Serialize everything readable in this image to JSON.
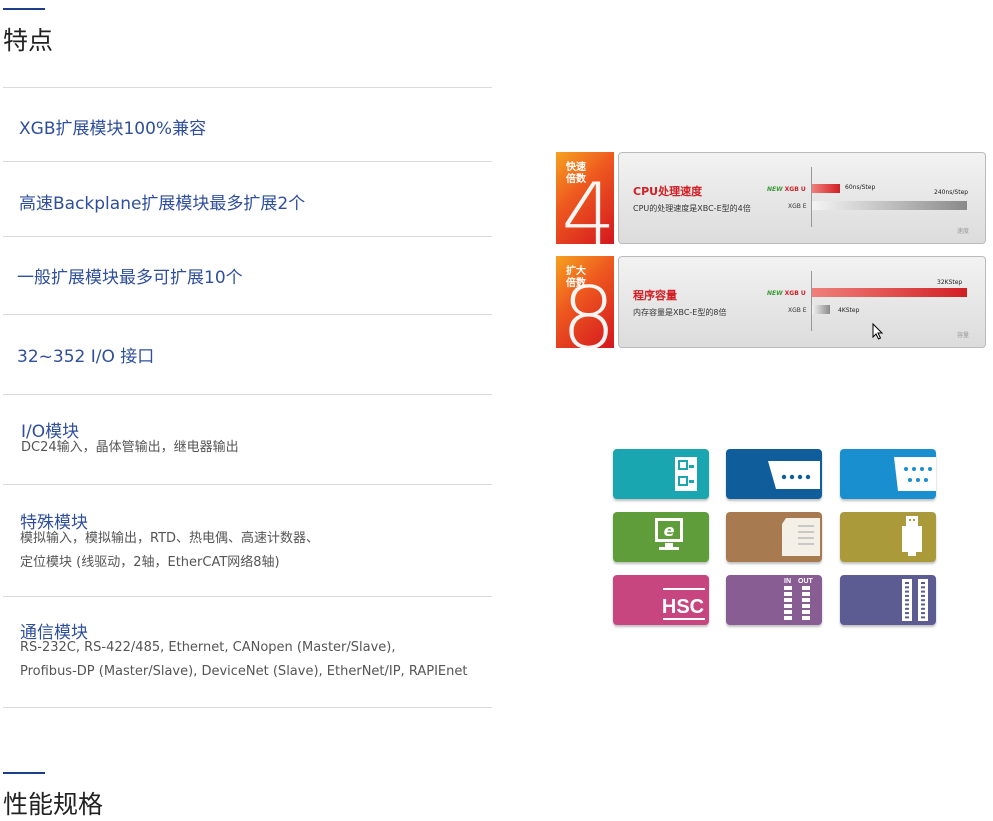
{
  "sections": {
    "features_title": "特点",
    "performance_title": "性能规格"
  },
  "features": [
    {
      "title": "XGB扩展模块100%兼容"
    },
    {
      "title": "高速Backplane扩展模块最多扩展2个"
    },
    {
      "title": "一般扩展模块最多可扩展10个"
    },
    {
      "title": "32~352 I/O 接口"
    },
    {
      "title": "I/O模块",
      "desc": [
        "DC24输入，晶体管输出，继电器输出"
      ]
    },
    {
      "title": "特殊模块",
      "desc": [
        "模拟输入，模拟输出，RTD、热电偶、高速计数器、",
        "定位模块 (线驱动，2轴，EtherCAT网络8轴)"
      ]
    },
    {
      "title": "通信模块",
      "desc": [
        " RS-232C, RS-422/485, Ethernet, CANopen  (Master/Slave),",
        "Profibus-DP (Master/Slave), DeviceNet (Slave), EtherNet/IP, RAPIEnet"
      ]
    }
  ],
  "promo": [
    {
      "badge": [
        "快速",
        "倍数"
      ],
      "number": "4",
      "title": "CPU处理速度",
      "subtitle": "CPU的处理速度是XBC-E型的4倍",
      "new_tag": "NEW",
      "model_u": "XGB U",
      "model_e": "XGB E",
      "u_value_label": "60ns/Step",
      "e_value_label": "240ns/Step",
      "unit": "速度"
    },
    {
      "badge": [
        "扩大",
        "倍数"
      ],
      "number": "8",
      "title": "程序容量",
      "subtitle": "内存容量是XBC-E型的8倍",
      "new_tag": "NEW",
      "model_u": "XGB U",
      "model_e": "XGB E",
      "u_value_label": "32KStep",
      "e_value_label": "4KStep",
      "unit": "容量"
    }
  ],
  "module_icons": [
    {
      "name": "io-terminal-icon",
      "color": "#1aa6b0"
    },
    {
      "name": "serial-port-icon",
      "color": "#0f5d9a"
    },
    {
      "name": "dsub-port-icon",
      "color": "#1a8fd0"
    },
    {
      "name": "ethernet-monitor-icon",
      "color": "#5f9d3b"
    },
    {
      "name": "memory-card-icon",
      "color": "#a87a4f"
    },
    {
      "name": "usb-icon",
      "color": "#ab9a3a"
    },
    {
      "name": "hsc-icon",
      "color": "#c8467f",
      "text": "HSC"
    },
    {
      "name": "in-out-module-icon",
      "color": "#875d93",
      "text_in": "IN",
      "text_out": "OUT"
    },
    {
      "name": "connector-module-icon",
      "color": "#5d5c92"
    }
  ]
}
